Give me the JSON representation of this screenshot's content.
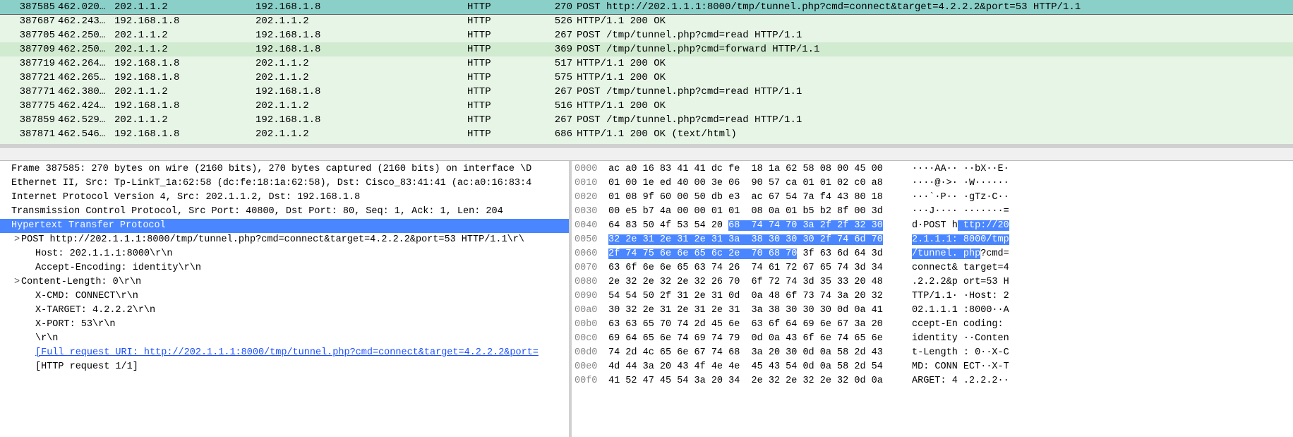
{
  "packets": [
    {
      "no": "387585",
      "time": "462.020…",
      "src": "202.1.1.2",
      "dst": "192.168.1.8",
      "proto": "HTTP",
      "len": "270",
      "info": "POST http://202.1.1.1:8000/tmp/tunnel.php?cmd=connect&target=4.2.2.2&port=53 HTTP/1.1",
      "cls": "selected"
    },
    {
      "no": "387687",
      "time": "462.243…",
      "src": "192.168.1.8",
      "dst": "202.1.1.2",
      "proto": "HTTP",
      "len": "526",
      "info": "HTTP/1.1 200 OK",
      "cls": "normal"
    },
    {
      "no": "387705",
      "time": "462.250…",
      "src": "202.1.1.2",
      "dst": "192.168.1.8",
      "proto": "HTTP",
      "len": "267",
      "info": "POST /tmp/tunnel.php?cmd=read HTTP/1.1",
      "cls": "normal"
    },
    {
      "no": "387709",
      "time": "462.250…",
      "src": "202.1.1.2",
      "dst": "192.168.1.8",
      "proto": "HTTP",
      "len": "369",
      "info": "POST /tmp/tunnel.php?cmd=forward HTTP/1.1",
      "cls": "mark"
    },
    {
      "no": "387719",
      "time": "462.264…",
      "src": "192.168.1.8",
      "dst": "202.1.1.2",
      "proto": "HTTP",
      "len": "517",
      "info": "HTTP/1.1 200 OK",
      "cls": "normal"
    },
    {
      "no": "387721",
      "time": "462.265…",
      "src": "192.168.1.8",
      "dst": "202.1.1.2",
      "proto": "HTTP",
      "len": "575",
      "info": "HTTP/1.1 200 OK",
      "cls": "normal"
    },
    {
      "no": "387771",
      "time": "462.380…",
      "src": "202.1.1.2",
      "dst": "192.168.1.8",
      "proto": "HTTP",
      "len": "267",
      "info": "POST /tmp/tunnel.php?cmd=read HTTP/1.1",
      "cls": "normal"
    },
    {
      "no": "387775",
      "time": "462.424…",
      "src": "192.168.1.8",
      "dst": "202.1.1.2",
      "proto": "HTTP",
      "len": "516",
      "info": "HTTP/1.1 200 OK",
      "cls": "normal"
    },
    {
      "no": "387859",
      "time": "462.529…",
      "src": "202.1.1.2",
      "dst": "192.168.1.8",
      "proto": "HTTP",
      "len": "267",
      "info": "POST /tmp/tunnel.php?cmd=read HTTP/1.1",
      "cls": "normal"
    },
    {
      "no": "387871",
      "time": "462.546…",
      "src": "192.168.1.8",
      "dst": "202.1.1.2",
      "proto": "HTTP",
      "len": "686",
      "info": "HTTP/1.1 200 OK  (text/html)",
      "cls": "normal"
    }
  ],
  "details": [
    {
      "lvl": 0,
      "twist": "",
      "cls": "",
      "text": "Frame 387585: 270 bytes on wire (2160 bits), 270 bytes captured (2160 bits) on interface \\D"
    },
    {
      "lvl": 0,
      "twist": "",
      "cls": "",
      "text": "Ethernet II, Src: Tp-LinkT_1a:62:58 (dc:fe:18:1a:62:58), Dst: Cisco_83:41:41 (ac:a0:16:83:4"
    },
    {
      "lvl": 0,
      "twist": "",
      "cls": "",
      "text": "Internet Protocol Version 4, Src: 202.1.1.2, Dst: 192.168.1.8"
    },
    {
      "lvl": 0,
      "twist": "",
      "cls": "",
      "text": "Transmission Control Protocol, Src Port: 40800, Dst Port: 80, Seq: 1, Ack: 1, Len: 204"
    },
    {
      "lvl": 0,
      "twist": "",
      "cls": "sel",
      "text": "Hypertext Transfer Protocol"
    },
    {
      "lvl": 1,
      "twist": ">",
      "cls": "",
      "text": "POST http://202.1.1.1:8000/tmp/tunnel.php?cmd=connect&target=4.2.2.2&port=53 HTTP/1.1\\r\\"
    },
    {
      "lvl": 2,
      "twist": "",
      "cls": "",
      "text": "Host: 202.1.1.1:8000\\r\\n"
    },
    {
      "lvl": 2,
      "twist": "",
      "cls": "",
      "text": "Accept-Encoding: identity\\r\\n"
    },
    {
      "lvl": 1,
      "twist": ">",
      "cls": "",
      "text": "Content-Length: 0\\r\\n"
    },
    {
      "lvl": 2,
      "twist": "",
      "cls": "",
      "text": "X-CMD: CONNECT\\r\\n"
    },
    {
      "lvl": 2,
      "twist": "",
      "cls": "",
      "text": "X-TARGET: 4.2.2.2\\r\\n"
    },
    {
      "lvl": 2,
      "twist": "",
      "cls": "",
      "text": "X-PORT: 53\\r\\n"
    },
    {
      "lvl": 2,
      "twist": "",
      "cls": "",
      "text": "\\r\\n"
    },
    {
      "lvl": 2,
      "twist": "",
      "cls": "link",
      "text": "[Full request URI: http://202.1.1.1:8000/tmp/tunnel.php?cmd=connect&target=4.2.2.2&port="
    },
    {
      "lvl": 2,
      "twist": "",
      "cls": "",
      "text": "[HTTP request 1/1]"
    }
  ],
  "hex": [
    {
      "off": "0000",
      "b1": "ac a0 16 83 41 41 dc fe  18 1a 62 58 08 00 45 00",
      "h1s": -1,
      "h1e": -1,
      "a": "····AA·· ··bX··E·",
      "has": -1,
      "hae": -1
    },
    {
      "off": "0010",
      "b1": "01 00 1e ed 40 00 3e 06  90 57 ca 01 01 02 c0 a8",
      "h1s": -1,
      "h1e": -1,
      "a": "····@·>· ·W······",
      "has": -1,
      "hae": -1
    },
    {
      "off": "0020",
      "b1": "01 08 9f 60 00 50 db e3  ac 67 54 7a f4 43 80 18",
      "h1s": -1,
      "h1e": -1,
      "a": "···`·P·· ·gTz·C··",
      "has": -1,
      "hae": -1
    },
    {
      "off": "0030",
      "b1": "00 e5 b7 4a 00 00 01 01  08 0a 01 b5 b2 8f 00 3d",
      "h1s": -1,
      "h1e": -1,
      "a": "···J···· ·······=",
      "has": -1,
      "hae": -1
    },
    {
      "off": "0040",
      "b1": "64 83 50 4f 53 54 20 68  74 74 70 3a 2f 2f 32 30",
      "h1s": 7,
      "h1e": 16,
      "a": "d·POST h ttp://20",
      "has": 8,
      "hae": 17
    },
    {
      "off": "0050",
      "b1": "32 2e 31 2e 31 2e 31 3a  38 30 30 30 2f 74 6d 70",
      "h1s": 0,
      "h1e": 16,
      "a": "2.1.1.1: 8000/tmp",
      "has": 0,
      "hae": 17
    },
    {
      "off": "0060",
      "b1": "2f 74 75 6e 6e 65 6c 2e  70 68 70 3f 63 6d 64 3d",
      "h1s": 0,
      "h1e": 11,
      "a": "/tunnel. php?cmd=",
      "has": 0,
      "hae": 12
    },
    {
      "off": "0070",
      "b1": "63 6f 6e 6e 65 63 74 26  74 61 72 67 65 74 3d 34",
      "h1s": -1,
      "h1e": -1,
      "a": "connect& target=4",
      "has": -1,
      "hae": -1
    },
    {
      "off": "0080",
      "b1": "2e 32 2e 32 2e 32 26 70  6f 72 74 3d 35 33 20 48",
      "h1s": -1,
      "h1e": -1,
      "a": ".2.2.2&p ort=53 H",
      "has": -1,
      "hae": -1
    },
    {
      "off": "0090",
      "b1": "54 54 50 2f 31 2e 31 0d  0a 48 6f 73 74 3a 20 32",
      "h1s": -1,
      "h1e": -1,
      "a": "TTP/1.1· ·Host: 2",
      "has": -1,
      "hae": -1
    },
    {
      "off": "00a0",
      "b1": "30 32 2e 31 2e 31 2e 31  3a 38 30 30 30 0d 0a 41",
      "h1s": -1,
      "h1e": -1,
      "a": "02.1.1.1 :8000··A",
      "has": -1,
      "hae": -1
    },
    {
      "off": "00b0",
      "b1": "63 63 65 70 74 2d 45 6e  63 6f 64 69 6e 67 3a 20",
      "h1s": -1,
      "h1e": -1,
      "a": "ccept-En coding: ",
      "has": -1,
      "hae": -1
    },
    {
      "off": "00c0",
      "b1": "69 64 65 6e 74 69 74 79  0d 0a 43 6f 6e 74 65 6e",
      "h1s": -1,
      "h1e": -1,
      "a": "identity ··Conten",
      "has": -1,
      "hae": -1
    },
    {
      "off": "00d0",
      "b1": "74 2d 4c 65 6e 67 74 68  3a 20 30 0d 0a 58 2d 43",
      "h1s": -1,
      "h1e": -1,
      "a": "t-Length : 0··X-C",
      "has": -1,
      "hae": -1
    },
    {
      "off": "00e0",
      "b1": "4d 44 3a 20 43 4f 4e 4e  45 43 54 0d 0a 58 2d 54",
      "h1s": -1,
      "h1e": -1,
      "a": "MD: CONN ECT··X-T",
      "has": -1,
      "hae": -1
    },
    {
      "off": "00f0",
      "b1": "41 52 47 45 54 3a 20 34  2e 32 2e 32 2e 32 0d 0a",
      "h1s": -1,
      "h1e": -1,
      "a": "ARGET: 4 .2.2.2··",
      "has": -1,
      "hae": -1
    }
  ]
}
